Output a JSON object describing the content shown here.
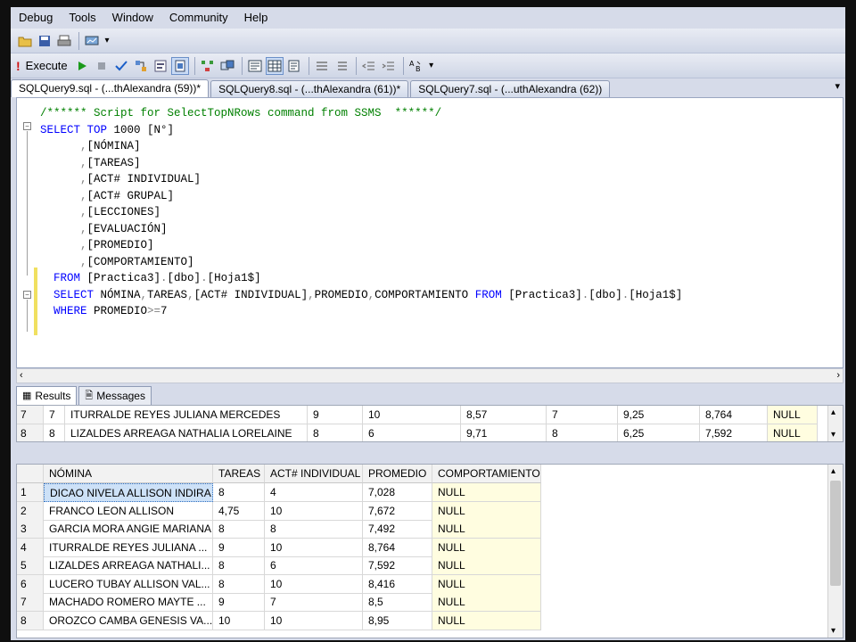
{
  "menu": [
    "Debug",
    "Tools",
    "Window",
    "Community",
    "Help"
  ],
  "toolbar": {
    "execute_label": "Execute"
  },
  "tabs": [
    {
      "label": "SQLQuery9.sql - (...thAlexandra (59))*",
      "active": true
    },
    {
      "label": "SQLQuery8.sql - (...thAlexandra (61))*",
      "active": false
    },
    {
      "label": "SQLQuery7.sql - (...uthAlexandra (62))",
      "active": false
    }
  ],
  "editor": {
    "lines": [
      {
        "tokens": [
          {
            "t": "/****** Script for SelectTopNRows command from SSMS  ******/",
            "c": "cm"
          }
        ]
      },
      {
        "tokens": [
          {
            "t": "SELECT TOP ",
            "c": "kw"
          },
          {
            "t": "1000 [N°]",
            "c": ""
          }
        ]
      },
      {
        "tokens": [
          {
            "t": "      ,",
            "c": "gr"
          },
          {
            "t": "[NÓMINA]",
            "c": ""
          }
        ]
      },
      {
        "tokens": [
          {
            "t": "      ,",
            "c": "gr"
          },
          {
            "t": "[TAREAS]",
            "c": ""
          }
        ]
      },
      {
        "tokens": [
          {
            "t": "      ,",
            "c": "gr"
          },
          {
            "t": "[ACT# INDIVIDUAL]",
            "c": ""
          }
        ]
      },
      {
        "tokens": [
          {
            "t": "      ,",
            "c": "gr"
          },
          {
            "t": "[ACT# GRUPAL]",
            "c": ""
          }
        ]
      },
      {
        "tokens": [
          {
            "t": "      ,",
            "c": "gr"
          },
          {
            "t": "[LECCIONES]",
            "c": ""
          }
        ]
      },
      {
        "tokens": [
          {
            "t": "      ,",
            "c": "gr"
          },
          {
            "t": "[EVALUACIÓN]",
            "c": ""
          }
        ]
      },
      {
        "tokens": [
          {
            "t": "      ,",
            "c": "gr"
          },
          {
            "t": "[PROMEDIO]",
            "c": ""
          }
        ]
      },
      {
        "tokens": [
          {
            "t": "      ,",
            "c": "gr"
          },
          {
            "t": "[COMPORTAMIENTO]",
            "c": ""
          }
        ]
      },
      {
        "tokens": [
          {
            "t": "  FROM ",
            "c": "kw"
          },
          {
            "t": "[Practica3]",
            "c": ""
          },
          {
            "t": ".",
            "c": "gr"
          },
          {
            "t": "[dbo]",
            "c": ""
          },
          {
            "t": ".",
            "c": "gr"
          },
          {
            "t": "[Hoja1$]",
            "c": ""
          }
        ]
      },
      {
        "tokens": [
          {
            "t": "  SELECT ",
            "c": "kw"
          },
          {
            "t": "NÓMINA",
            "c": ""
          },
          {
            "t": ",",
            "c": "gr"
          },
          {
            "t": "TAREAS",
            "c": ""
          },
          {
            "t": ",",
            "c": "gr"
          },
          {
            "t": "[ACT# INDIVIDUAL]",
            "c": ""
          },
          {
            "t": ",",
            "c": "gr"
          },
          {
            "t": "PROMEDIO",
            "c": ""
          },
          {
            "t": ",",
            "c": "gr"
          },
          {
            "t": "COMPORTAMIENTO ",
            "c": ""
          },
          {
            "t": "FROM ",
            "c": "kw"
          },
          {
            "t": "[Practica3]",
            "c": ""
          },
          {
            "t": ".",
            "c": "gr"
          },
          {
            "t": "[dbo]",
            "c": ""
          },
          {
            "t": ".",
            "c": "gr"
          },
          {
            "t": "[Hoja1$]",
            "c": ""
          }
        ]
      },
      {
        "tokens": [
          {
            "t": "  WHERE ",
            "c": "kw"
          },
          {
            "t": "PROMEDIO",
            "c": ""
          },
          {
            "t": ">=",
            "c": "gr"
          },
          {
            "t": "7",
            "c": ""
          }
        ]
      }
    ]
  },
  "results_tabs": [
    {
      "label": "Results",
      "icon": "grid-icon",
      "active": true
    },
    {
      "label": "Messages",
      "icon": "messages-icon",
      "active": false
    }
  ],
  "grid1": {
    "rows": [
      [
        "7",
        "7",
        "ITURRALDE REYES JULIANA MERCEDES",
        "9",
        "10",
        "8,57",
        "7",
        "9,25",
        "8,764",
        "NULL"
      ],
      [
        "8",
        "8",
        "LIZALDES ARREAGA NATHALIA LORELAINE",
        "8",
        "6",
        "9,71",
        "8",
        "6,25",
        "7,592",
        "NULL"
      ]
    ]
  },
  "grid2": {
    "columns": [
      "",
      "NÓMINA",
      "TAREAS",
      "ACT# INDIVIDUAL",
      "PROMEDIO",
      "COMPORTAMIENTO"
    ],
    "rows": [
      [
        "1",
        "DICAO NIVELA ALLISON INDIRA",
        "8",
        "4",
        "7,028",
        "NULL"
      ],
      [
        "2",
        "FRANCO LEON ALLISON",
        "4,75",
        "10",
        "7,672",
        "NULL"
      ],
      [
        "3",
        "GARCIA MORA ANGIE MARIANA",
        "8",
        "8",
        "7,492",
        "NULL"
      ],
      [
        "4",
        "ITURRALDE REYES JULIANA ...",
        "9",
        "10",
        "8,764",
        "NULL"
      ],
      [
        "5",
        "LIZALDES ARREAGA NATHALI...",
        "8",
        "6",
        "7,592",
        "NULL"
      ],
      [
        "6",
        "LUCERO TUBAY ALLISON VAL...",
        "8",
        "10",
        "8,416",
        "NULL"
      ],
      [
        "7",
        "MACHADO ROMERO MAYTE ...",
        "9",
        "7",
        "8,5",
        "NULL"
      ],
      [
        "8",
        "OROZCO CAMBA GENESIS VA...",
        "10",
        "10",
        "8,95",
        "NULL"
      ]
    ]
  }
}
